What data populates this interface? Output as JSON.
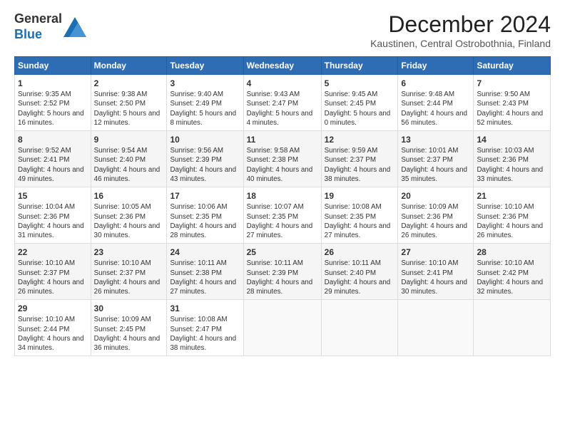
{
  "header": {
    "logo_line1": "General",
    "logo_line2": "Blue",
    "title": "December 2024",
    "subtitle": "Kaustinen, Central Ostrobothnia, Finland"
  },
  "calendar": {
    "weekdays": [
      "Sunday",
      "Monday",
      "Tuesday",
      "Wednesday",
      "Thursday",
      "Friday",
      "Saturday"
    ],
    "weeks": [
      [
        {
          "day": "1",
          "sunrise": "Sunrise: 9:35 AM",
          "sunset": "Sunset: 2:52 PM",
          "daylight": "Daylight: 5 hours and 16 minutes."
        },
        {
          "day": "2",
          "sunrise": "Sunrise: 9:38 AM",
          "sunset": "Sunset: 2:50 PM",
          "daylight": "Daylight: 5 hours and 12 minutes."
        },
        {
          "day": "3",
          "sunrise": "Sunrise: 9:40 AM",
          "sunset": "Sunset: 2:49 PM",
          "daylight": "Daylight: 5 hours and 8 minutes."
        },
        {
          "day": "4",
          "sunrise": "Sunrise: 9:43 AM",
          "sunset": "Sunset: 2:47 PM",
          "daylight": "Daylight: 5 hours and 4 minutes."
        },
        {
          "day": "5",
          "sunrise": "Sunrise: 9:45 AM",
          "sunset": "Sunset: 2:45 PM",
          "daylight": "Daylight: 5 hours and 0 minutes."
        },
        {
          "day": "6",
          "sunrise": "Sunrise: 9:48 AM",
          "sunset": "Sunset: 2:44 PM",
          "daylight": "Daylight: 4 hours and 56 minutes."
        },
        {
          "day": "7",
          "sunrise": "Sunrise: 9:50 AM",
          "sunset": "Sunset: 2:43 PM",
          "daylight": "Daylight: 4 hours and 52 minutes."
        }
      ],
      [
        {
          "day": "8",
          "sunrise": "Sunrise: 9:52 AM",
          "sunset": "Sunset: 2:41 PM",
          "daylight": "Daylight: 4 hours and 49 minutes."
        },
        {
          "day": "9",
          "sunrise": "Sunrise: 9:54 AM",
          "sunset": "Sunset: 2:40 PM",
          "daylight": "Daylight: 4 hours and 46 minutes."
        },
        {
          "day": "10",
          "sunrise": "Sunrise: 9:56 AM",
          "sunset": "Sunset: 2:39 PM",
          "daylight": "Daylight: 4 hours and 43 minutes."
        },
        {
          "day": "11",
          "sunrise": "Sunrise: 9:58 AM",
          "sunset": "Sunset: 2:38 PM",
          "daylight": "Daylight: 4 hours and 40 minutes."
        },
        {
          "day": "12",
          "sunrise": "Sunrise: 9:59 AM",
          "sunset": "Sunset: 2:37 PM",
          "daylight": "Daylight: 4 hours and 38 minutes."
        },
        {
          "day": "13",
          "sunrise": "Sunrise: 10:01 AM",
          "sunset": "Sunset: 2:37 PM",
          "daylight": "Daylight: 4 hours and 35 minutes."
        },
        {
          "day": "14",
          "sunrise": "Sunrise: 10:03 AM",
          "sunset": "Sunset: 2:36 PM",
          "daylight": "Daylight: 4 hours and 33 minutes."
        }
      ],
      [
        {
          "day": "15",
          "sunrise": "Sunrise: 10:04 AM",
          "sunset": "Sunset: 2:36 PM",
          "daylight": "Daylight: 4 hours and 31 minutes."
        },
        {
          "day": "16",
          "sunrise": "Sunrise: 10:05 AM",
          "sunset": "Sunset: 2:36 PM",
          "daylight": "Daylight: 4 hours and 30 minutes."
        },
        {
          "day": "17",
          "sunrise": "Sunrise: 10:06 AM",
          "sunset": "Sunset: 2:35 PM",
          "daylight": "Daylight: 4 hours and 28 minutes."
        },
        {
          "day": "18",
          "sunrise": "Sunrise: 10:07 AM",
          "sunset": "Sunset: 2:35 PM",
          "daylight": "Daylight: 4 hours and 27 minutes."
        },
        {
          "day": "19",
          "sunrise": "Sunrise: 10:08 AM",
          "sunset": "Sunset: 2:35 PM",
          "daylight": "Daylight: 4 hours and 27 minutes."
        },
        {
          "day": "20",
          "sunrise": "Sunrise: 10:09 AM",
          "sunset": "Sunset: 2:36 PM",
          "daylight": "Daylight: 4 hours and 26 minutes."
        },
        {
          "day": "21",
          "sunrise": "Sunrise: 10:10 AM",
          "sunset": "Sunset: 2:36 PM",
          "daylight": "Daylight: 4 hours and 26 minutes."
        }
      ],
      [
        {
          "day": "22",
          "sunrise": "Sunrise: 10:10 AM",
          "sunset": "Sunset: 2:37 PM",
          "daylight": "Daylight: 4 hours and 26 minutes."
        },
        {
          "day": "23",
          "sunrise": "Sunrise: 10:10 AM",
          "sunset": "Sunset: 2:37 PM",
          "daylight": "Daylight: 4 hours and 26 minutes."
        },
        {
          "day": "24",
          "sunrise": "Sunrise: 10:11 AM",
          "sunset": "Sunset: 2:38 PM",
          "daylight": "Daylight: 4 hours and 27 minutes."
        },
        {
          "day": "25",
          "sunrise": "Sunrise: 10:11 AM",
          "sunset": "Sunset: 2:39 PM",
          "daylight": "Daylight: 4 hours and 28 minutes."
        },
        {
          "day": "26",
          "sunrise": "Sunrise: 10:11 AM",
          "sunset": "Sunset: 2:40 PM",
          "daylight": "Daylight: 4 hours and 29 minutes."
        },
        {
          "day": "27",
          "sunrise": "Sunrise: 10:10 AM",
          "sunset": "Sunset: 2:41 PM",
          "daylight": "Daylight: 4 hours and 30 minutes."
        },
        {
          "day": "28",
          "sunrise": "Sunrise: 10:10 AM",
          "sunset": "Sunset: 2:42 PM",
          "daylight": "Daylight: 4 hours and 32 minutes."
        }
      ],
      [
        {
          "day": "29",
          "sunrise": "Sunrise: 10:10 AM",
          "sunset": "Sunset: 2:44 PM",
          "daylight": "Daylight: 4 hours and 34 minutes."
        },
        {
          "day": "30",
          "sunrise": "Sunrise: 10:09 AM",
          "sunset": "Sunset: 2:45 PM",
          "daylight": "Daylight: 4 hours and 36 minutes."
        },
        {
          "day": "31",
          "sunrise": "Sunrise: 10:08 AM",
          "sunset": "Sunset: 2:47 PM",
          "daylight": "Daylight: 4 hours and 38 minutes."
        },
        null,
        null,
        null,
        null
      ]
    ]
  }
}
